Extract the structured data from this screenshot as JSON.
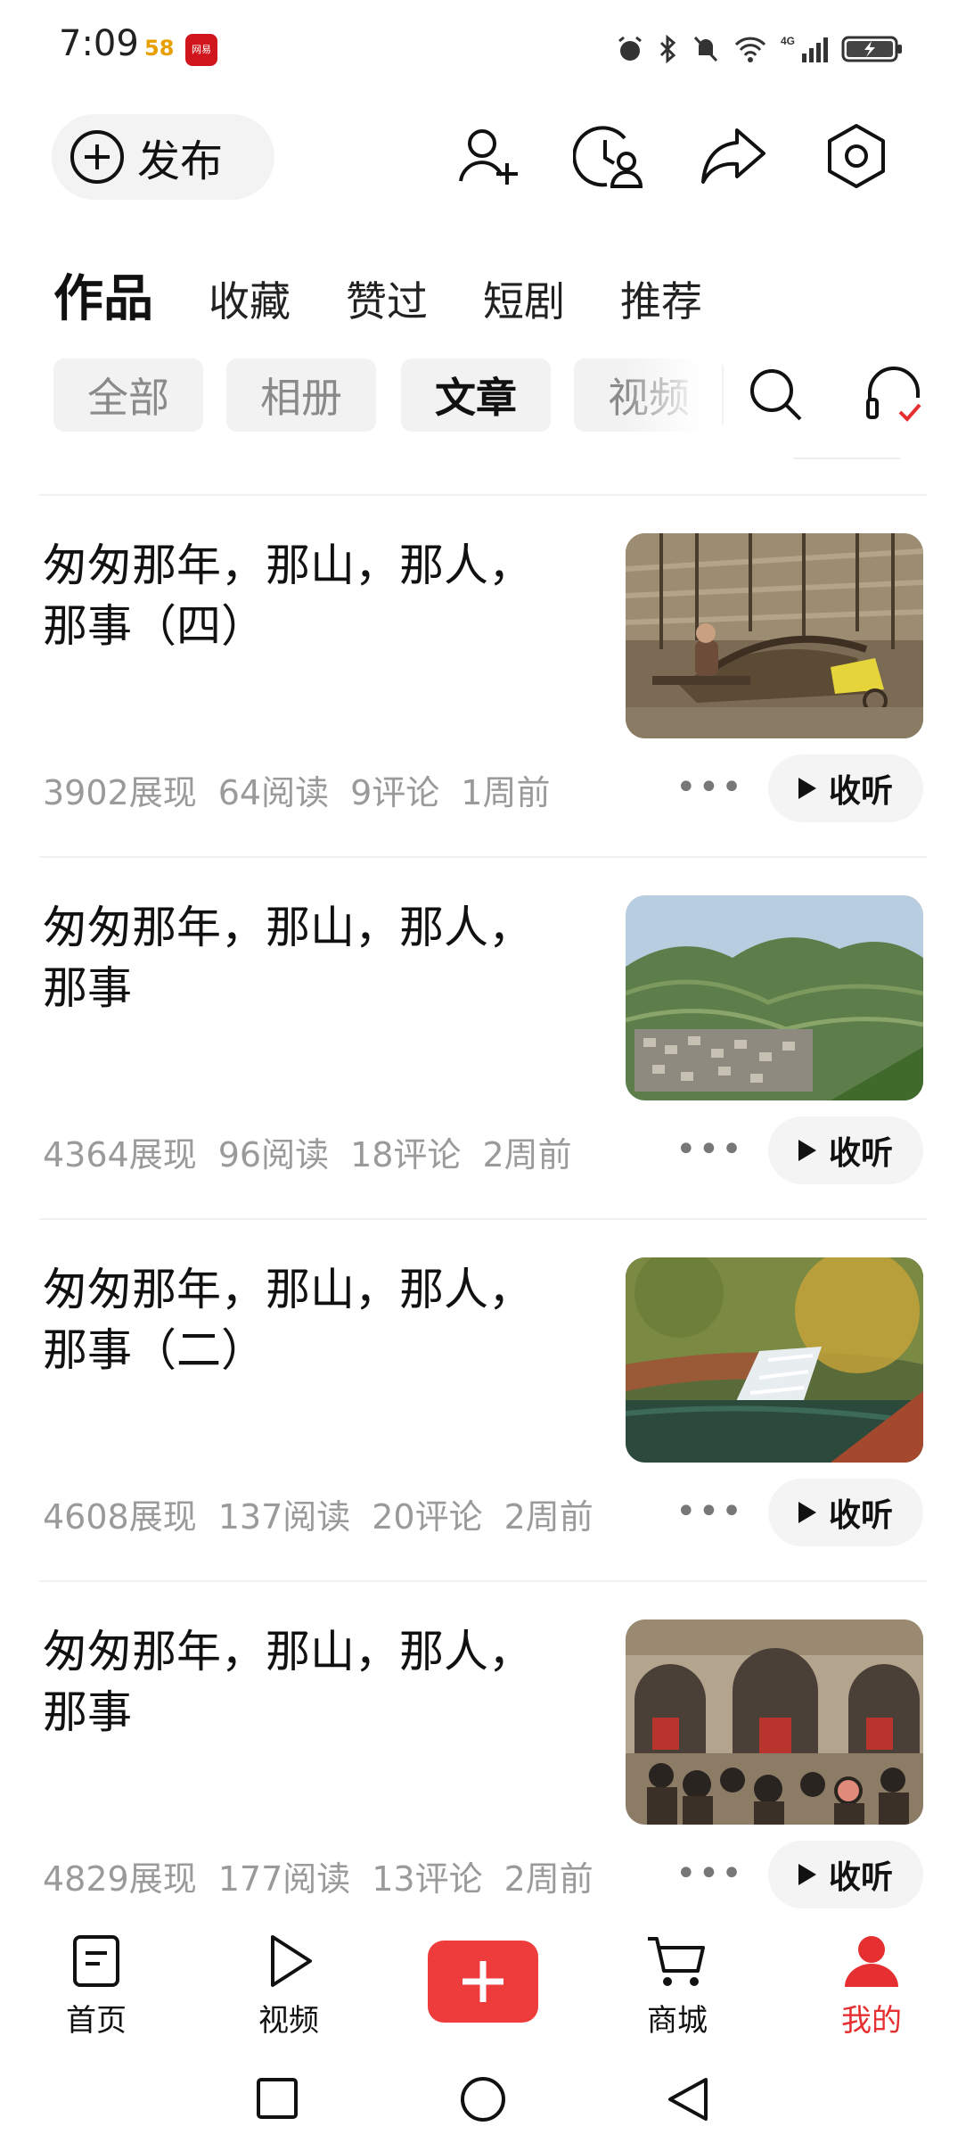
{
  "status_bar": {
    "time": "7:09",
    "badge_58": "58",
    "app_badge": "网易",
    "network": "4G"
  },
  "header": {
    "publish_label": "发布",
    "icons": [
      "add-friend-icon",
      "history-icon",
      "share-icon",
      "settings-icon"
    ]
  },
  "tabs": [
    "作品",
    "收藏",
    "赞过",
    "短剧",
    "推荐"
  ],
  "filters": [
    "全部",
    "相册",
    "文章",
    "视频"
  ],
  "active_filter": "文章",
  "articles": [
    {
      "title_line1": "匆匆那年，那山，那人，",
      "title_line2": "那事（四）",
      "impressions": "3902展现",
      "reads": "64阅读",
      "comments": "9评论",
      "time": "1周前",
      "more": "•••",
      "listen": "收听",
      "image": "old man resting on cart in mountain village"
    },
    {
      "title_line1": "匆匆那年，那山，那人，",
      "title_line2": "那事",
      "impressions": "4364展现",
      "reads": "96阅读",
      "comments": "18评论",
      "time": "2周前",
      "more": "•••",
      "listen": "收听",
      "image": "terraced mountain village landscape"
    },
    {
      "title_line1": "匆匆那年，那山，那人，",
      "title_line2": "那事（二）",
      "impressions": "4608展现",
      "reads": "137阅读",
      "comments": "20评论",
      "time": "2周前",
      "more": "•••",
      "listen": "收听",
      "image": "waterfall among autumn trees"
    },
    {
      "title_line1": "匆匆那年，那山，那人，",
      "title_line2": "那事",
      "impressions": "4829展现",
      "reads": "177阅读",
      "comments": "13评论",
      "time": "2周前",
      "more": "•••",
      "listen": "收听",
      "image": "villagers in front of cave dwellings"
    }
  ],
  "bottom_nav": [
    {
      "label": "首页",
      "icon": "home-doc-icon"
    },
    {
      "label": "视频",
      "icon": "play-icon"
    },
    {
      "label": "",
      "icon": "plus-icon"
    },
    {
      "label": "商城",
      "icon": "cart-icon"
    },
    {
      "label": "我的",
      "icon": "profile-icon"
    }
  ],
  "colors": {
    "accent": "#e62f31",
    "chip_bg": "#f2f2f2",
    "muted_text": "#9a9a9a"
  }
}
